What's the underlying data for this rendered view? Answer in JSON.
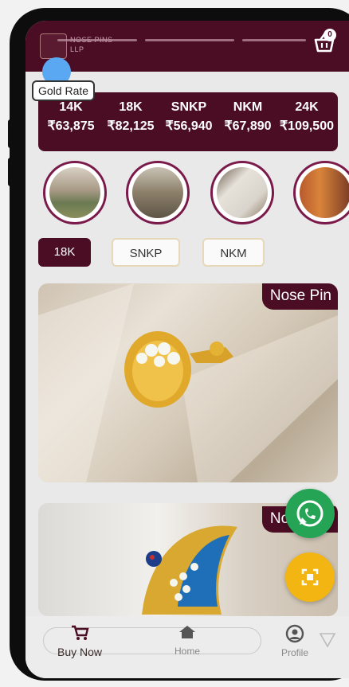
{
  "header": {
    "logo_text_line1": "NOSE PINS",
    "logo_text_line2": "LLP",
    "cart_count": "0"
  },
  "gold_rate": {
    "chip_label": "Gold Rate",
    "rates": [
      {
        "karat": "14K",
        "price": "₹63,875"
      },
      {
        "karat": "18K",
        "price": "₹82,125"
      },
      {
        "karat": "SNKP",
        "price": "₹56,940"
      },
      {
        "karat": "NKM",
        "price": "₹67,890"
      },
      {
        "karat": "24K",
        "price": "₹109,500"
      }
    ]
  },
  "filters": [
    {
      "label": "18K",
      "selected": true
    },
    {
      "label": "SNKP",
      "selected": false
    },
    {
      "label": "NKM",
      "selected": false
    }
  ],
  "products": [
    {
      "label": "Nose Pin"
    },
    {
      "label": "Nose Pin"
    }
  ],
  "bottom_nav": {
    "items": [
      {
        "label": "Buy Now",
        "icon": "cart-icon"
      },
      {
        "label": "Home",
        "icon": "home-icon"
      },
      {
        "label": "Profile",
        "icon": "profile-icon"
      }
    ]
  },
  "colors": {
    "brand": "#4b0d24",
    "whatsapp": "#25a455",
    "scan_fab": "#f2b512"
  }
}
